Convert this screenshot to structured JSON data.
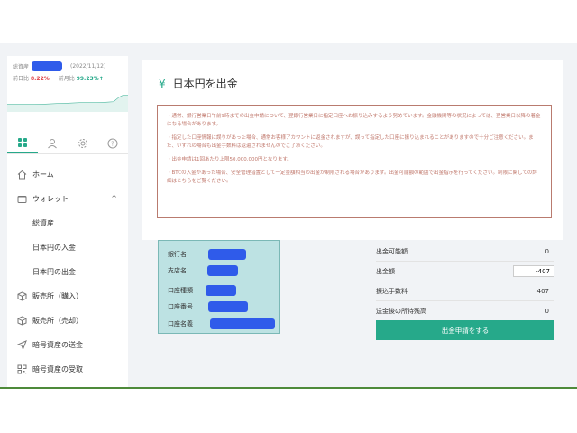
{
  "balance": {
    "label": "総資産",
    "date": "(2022/11/12)",
    "prev_day_label": "前日比",
    "prev_day_value": "8.22%",
    "prev_month_label": "前月比",
    "prev_month_value": "99.23%↑"
  },
  "tabs": [
    {
      "icon": "grid-icon"
    },
    {
      "icon": "user-icon"
    },
    {
      "icon": "gear-icon"
    },
    {
      "icon": "help-icon"
    }
  ],
  "nav": {
    "home": "ホーム",
    "wallet": "ウォレット",
    "total_assets": "総資産",
    "jpy_deposit": "日本円の入金",
    "jpy_withdraw": "日本円の出金",
    "buy": "販売所（購入）",
    "sell": "販売所（売却）",
    "crypto_send": "暗号資産の送金",
    "crypto_receive": "暗号資産の受取"
  },
  "page": {
    "yen_symbol": "¥",
    "title": "日本円を出金"
  },
  "notices": [
    "・通常、銀行営業日午前9時までの出金申請について、翌銀行営業日に指定口座へお振り込みするよう努めています。金融機関等の状況によっては、翌営業日以降の着金になる場合があります。",
    "・指定した口座情報に誤りがあった場合、通常お客様アカウントに返金されますが、誤って指定した口座に振り込まれることがありますので十分ご注意ください。また、いずれの場合も出金手数料は返還されませんのでご了承ください。",
    "・出金申請は1回あたり上限50,000,000円となります。",
    "・BTCの入金があった場合、安全管理措置として一定金額相当の出金が制限される場合があります。出金可能額の範囲で出金指示を行ってください。制限に関しての詳細はこちらをご覧ください。"
  ],
  "bank": {
    "bank_name": "銀行名",
    "branch_name": "支店名",
    "account_type": "口座種類",
    "account_number": "口座番号",
    "account_holder": "口座名義"
  },
  "summary": {
    "available_label": "出金可能額",
    "available_value": "0",
    "amount_label": "出金額",
    "amount_value": "-407",
    "fee_label": "振込手数料",
    "fee_value": "407",
    "after_label": "送金後の所持残高",
    "after_value": "0"
  },
  "submit_label": "出金申請をする",
  "colors": {
    "accent": "#26a98a",
    "mask": "#2f5bea",
    "notice": "#c0776b",
    "bank_bg": "#bde2e3"
  }
}
